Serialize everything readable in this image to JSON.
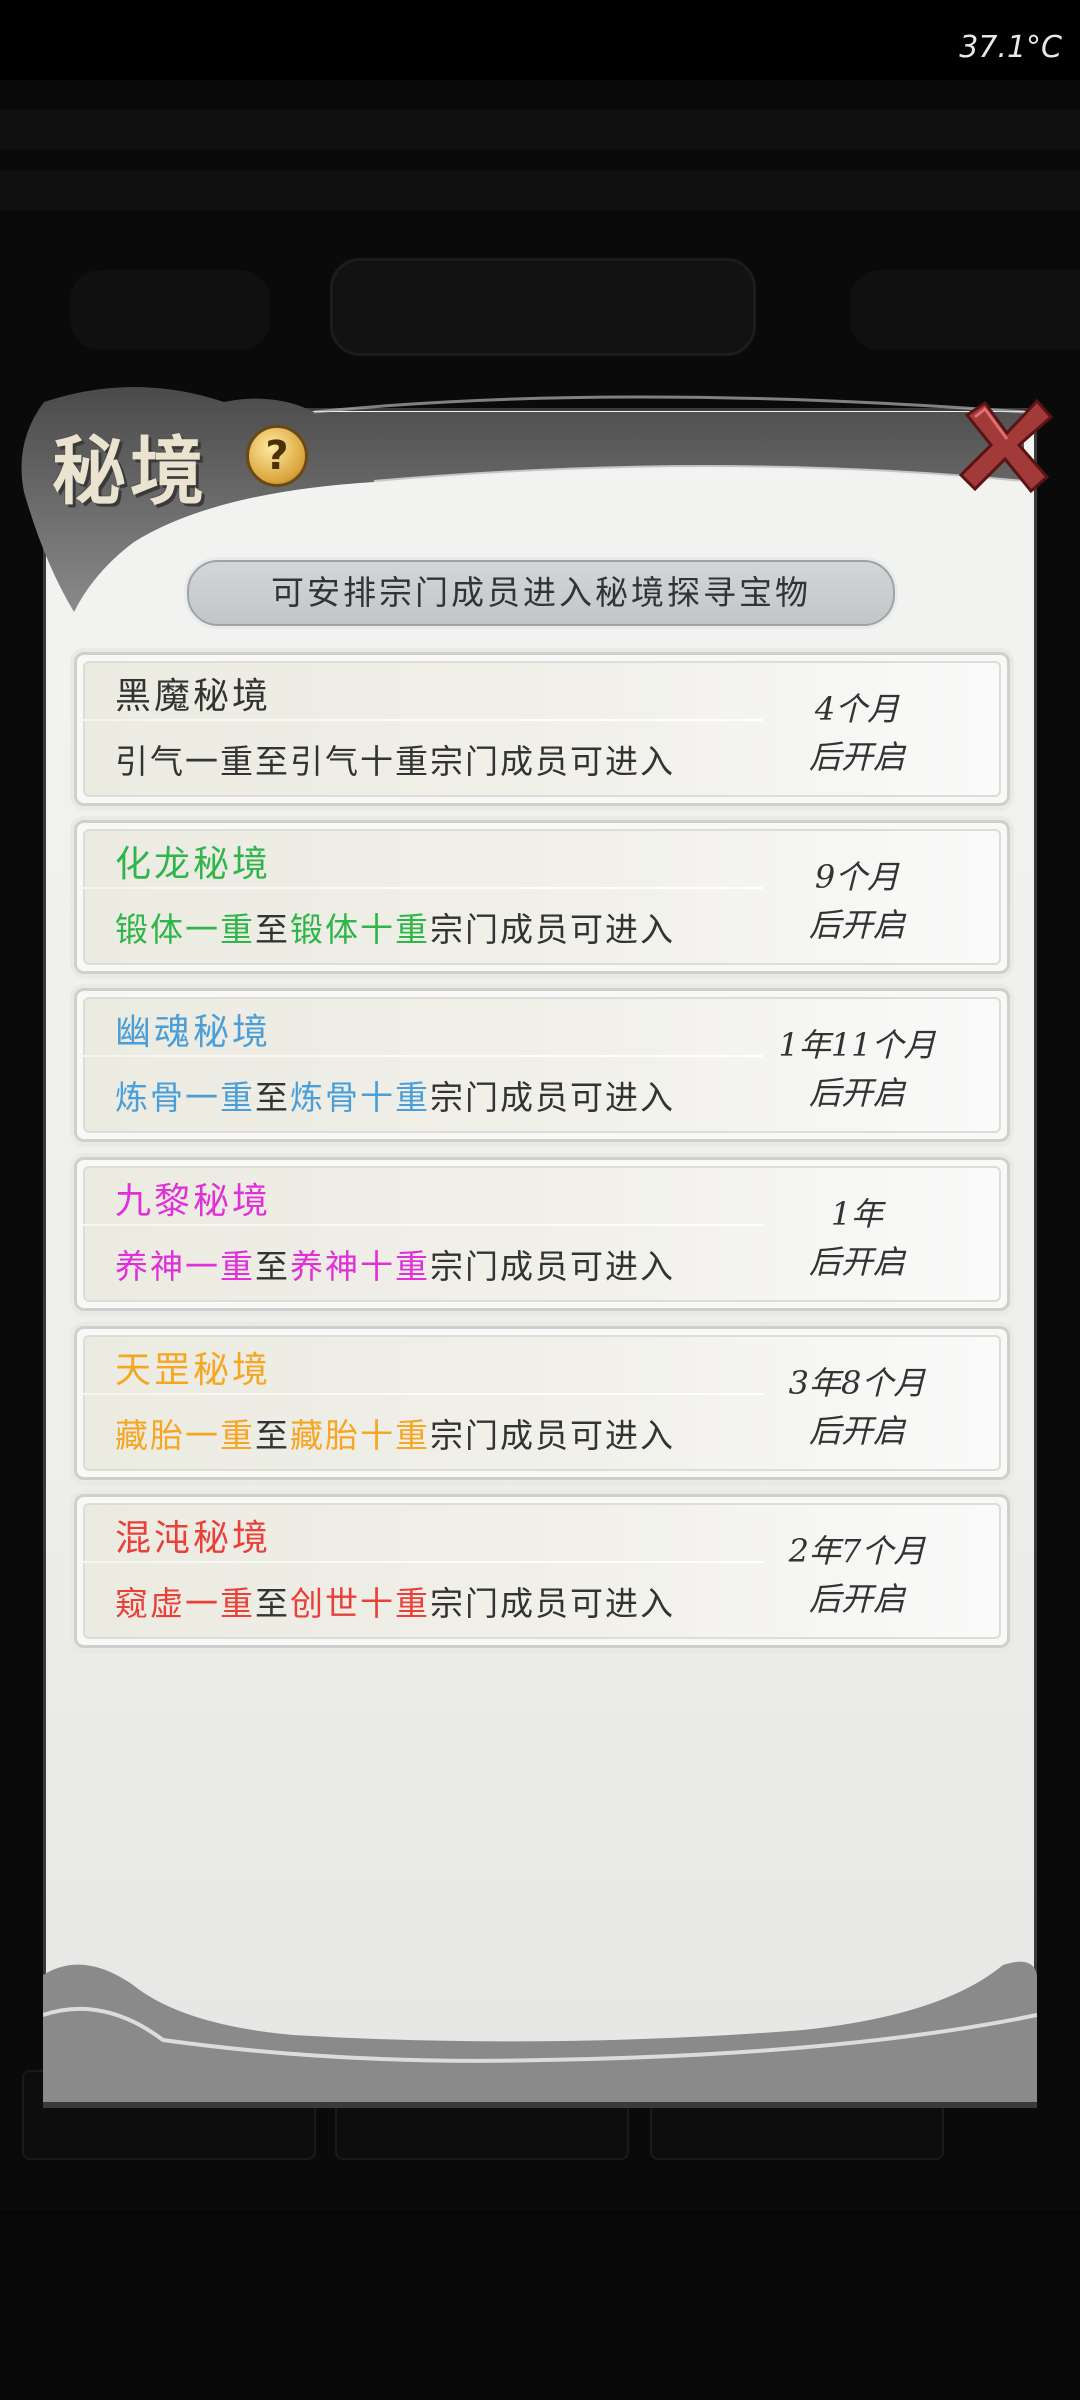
{
  "status_bar": {
    "temperature": "37.1°C"
  },
  "dialog": {
    "title": "秘境",
    "help_symbol": "?",
    "subtitle": "可安排宗门成员进入秘境探寻宝物",
    "colors": {
      "gray": "#333333",
      "green": "#2fb54a",
      "blue": "#4a9fd8",
      "magenta": "#e030d8",
      "orange": "#f5a623",
      "red": "#e8413a"
    },
    "realms": [
      {
        "name": "黑魔秘境",
        "color": "#333333",
        "from": "引气一重",
        "to": "引气十重",
        "suffix": "宗门成员可进入",
        "mid": "至",
        "time_line1": "4个月",
        "time_line2": "后开启"
      },
      {
        "name": "化龙秘境",
        "color": "#2fb54a",
        "from": "锻体一重",
        "to": "锻体十重",
        "suffix": "宗门成员可进入",
        "mid": "至",
        "time_line1": "9个月",
        "time_line2": "后开启"
      },
      {
        "name": "幽魂秘境",
        "color": "#4a9fd8",
        "from": "炼骨一重",
        "to": "炼骨十重",
        "suffix": "宗门成员可进入",
        "mid": "至",
        "time_line1": "1年11个月",
        "time_line2": "后开启"
      },
      {
        "name": "九黎秘境",
        "color": "#e030d8",
        "from": "养神一重",
        "to": "养神十重",
        "suffix": "宗门成员可进入",
        "mid": "至",
        "time_line1": "1年",
        "time_line2": "后开启"
      },
      {
        "name": "天罡秘境",
        "color": "#f5a623",
        "from": "藏胎一重",
        "to": "藏胎十重",
        "suffix": "宗门成员可进入",
        "mid": "至",
        "time_line1": "3年8个月",
        "time_line2": "后开启"
      },
      {
        "name": "混沌秘境",
        "color": "#e8413a",
        "from": "窥虚一重",
        "to": "创世十重",
        "suffix": "宗门成员可进入",
        "mid": "至",
        "time_line1": "2年7个月",
        "time_line2": "后开启"
      }
    ]
  }
}
